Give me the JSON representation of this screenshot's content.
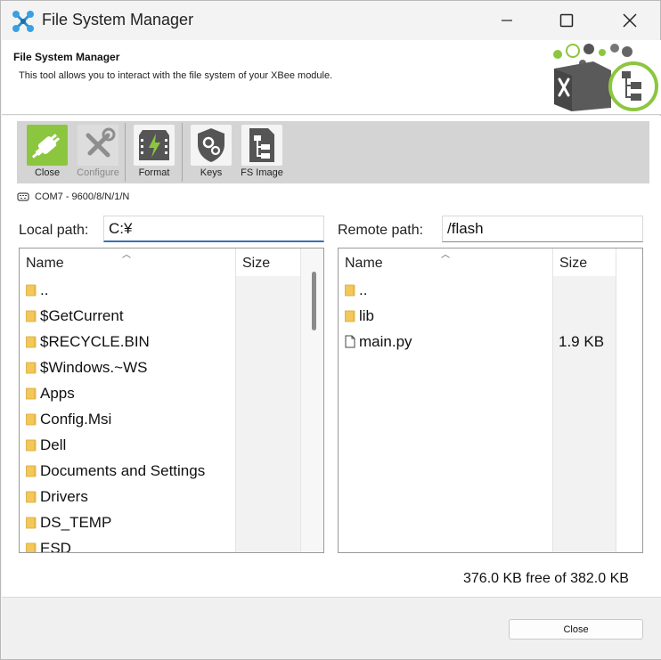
{
  "window": {
    "title": "File System Manager"
  },
  "header": {
    "title": "File System Manager",
    "subtitle": "This tool allows you to interact with the file system of your XBee module."
  },
  "toolbar": {
    "close": {
      "label": "Close",
      "icon": "plug-connector-icon",
      "enabled": true,
      "accent": "#8cc63f"
    },
    "configure": {
      "label": "Configure",
      "icon": "wrench-screwdriver-icon",
      "enabled": false
    },
    "format": {
      "label": "Format",
      "icon": "memory-chip-bolt-icon",
      "enabled": true
    },
    "keys": {
      "label": "Keys",
      "icon": "shield-gear-icon",
      "enabled": true
    },
    "fs_image": {
      "label": "FS Image",
      "icon": "file-tree-icon",
      "enabled": true
    }
  },
  "connection": {
    "port_text": "COM7 - 9600/8/N/1/N",
    "icon": "serial-port-icon"
  },
  "local": {
    "path_label": "Local path:",
    "path_value": "C:¥",
    "columns": {
      "name": "Name",
      "size": "Size"
    },
    "items": [
      {
        "name": "..",
        "type": "folder",
        "size": ""
      },
      {
        "name": "$GetCurrent",
        "type": "folder",
        "size": ""
      },
      {
        "name": "$RECYCLE.BIN",
        "type": "folder",
        "size": ""
      },
      {
        "name": "$Windows.~WS",
        "type": "folder",
        "size": ""
      },
      {
        "name": "Apps",
        "type": "folder",
        "size": ""
      },
      {
        "name": "Config.Msi",
        "type": "folder",
        "size": ""
      },
      {
        "name": "Dell",
        "type": "folder",
        "size": ""
      },
      {
        "name": "Documents and Settings",
        "type": "folder",
        "size": ""
      },
      {
        "name": "Drivers",
        "type": "folder",
        "size": ""
      },
      {
        "name": "DS_TEMP",
        "type": "folder",
        "size": ""
      },
      {
        "name": "ESD",
        "type": "folder",
        "size": ""
      }
    ]
  },
  "remote": {
    "path_label": "Remote path:",
    "path_value": "/flash",
    "columns": {
      "name": "Name",
      "size": "Size"
    },
    "items": [
      {
        "name": "..",
        "type": "folder",
        "size": ""
      },
      {
        "name": "lib",
        "type": "folder",
        "size": ""
      },
      {
        "name": "main.py",
        "type": "file",
        "size": "1.9 KB"
      }
    ]
  },
  "status": {
    "free_space": "376.0 KB free of 382.0 KB"
  },
  "footer": {
    "close_label": "Close"
  },
  "colors": {
    "folder": "#f3c85a",
    "accent_green": "#8cc63f",
    "focus_blue": "#3b6fb5"
  }
}
